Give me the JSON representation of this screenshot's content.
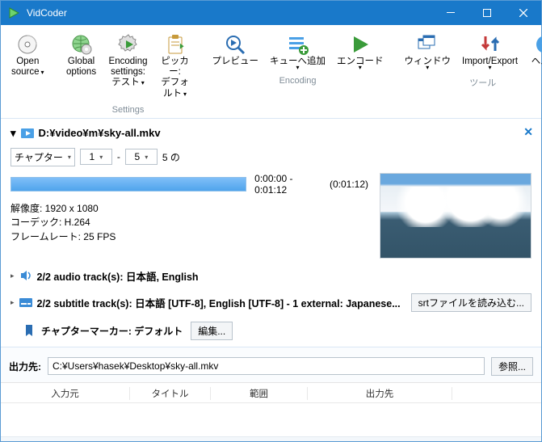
{
  "titlebar": {
    "app_name": "VidCoder"
  },
  "toolbar": {
    "open_source": "Open\nsource",
    "global_options": "Global\noptions",
    "encoding_settings": "Encoding\nsettings: テスト",
    "picker": "ピッカー:\nデフォルト",
    "preview": "プレビュー",
    "add_to_queue": "キューへ追加",
    "encode": "エンコード",
    "window": "ウィンドウ",
    "import_export": "Import/Export",
    "help": "ヘルプ",
    "group_settings": "Settings",
    "group_encoding": "Encoding",
    "group_tools": "ツール"
  },
  "source": {
    "path": "D:¥video¥m¥sky-all.mkv",
    "chapter_label": "チャプター",
    "chapter_start": "1",
    "chapter_end": "5",
    "chapter_suffix": "5 の",
    "time_range": "0:00:00 - 0:01:12",
    "duration": "(0:01:12)",
    "resolution": "解像度: 1920 x 1080",
    "codec": "コーデック: H.264",
    "framerate": "フレームレート: 25 FPS",
    "audio_summary": "2/2 audio track(s): 日本語, English",
    "sub_summary": "2/2 subtitle track(s): 日本語 [UTF-8], English [UTF-8] - 1 external: Japanese...",
    "srt_button": "srtファイルを読み込む...",
    "chapter_markers": "チャプターマーカー: デフォルト",
    "edit_button": "編集..."
  },
  "output": {
    "label": "出力先:",
    "path": "C:¥Users¥hasek¥Desktop¥sky-all.mkv",
    "browse": "参照..."
  },
  "queue": {
    "col_source": "入力元",
    "col_title": "タイトル",
    "col_range": "範囲",
    "col_dest": "出力先",
    "col_blank": ""
  }
}
